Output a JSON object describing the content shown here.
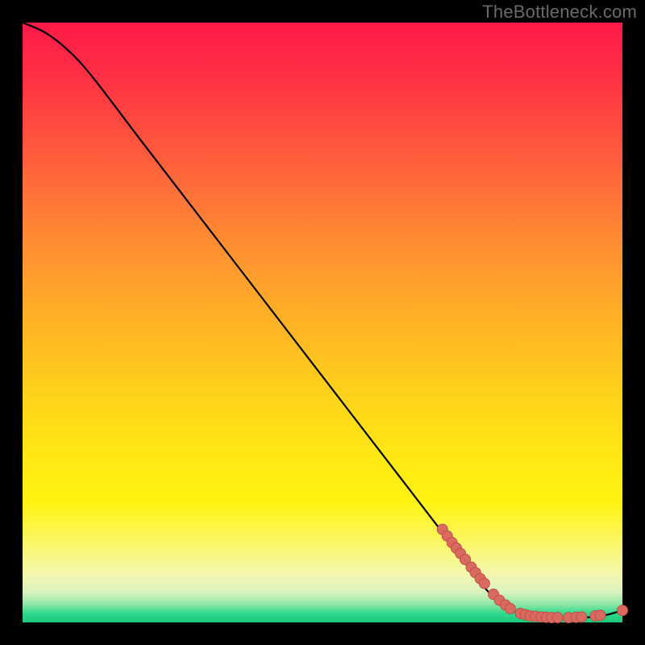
{
  "watermark": "TheBottleneck.com",
  "colors": {
    "page_bg": "#000000",
    "watermark_text": "#6a6a6a",
    "curve_stroke": "#000000",
    "point_fill": "#d86a60",
    "point_stroke": "#c24f45"
  },
  "chart_data": {
    "type": "line",
    "title": "",
    "xlabel": "",
    "ylabel": "",
    "xlim": [
      0,
      100
    ],
    "ylim": [
      0,
      100
    ],
    "curve": [
      {
        "x": 0,
        "y": 100
      },
      {
        "x": 4,
        "y": 98.2
      },
      {
        "x": 8,
        "y": 95.0
      },
      {
        "x": 12,
        "y": 90.5
      },
      {
        "x": 20,
        "y": 80.0
      },
      {
        "x": 30,
        "y": 67.0
      },
      {
        "x": 40,
        "y": 54.0
      },
      {
        "x": 50,
        "y": 41.0
      },
      {
        "x": 60,
        "y": 28.0
      },
      {
        "x": 70,
        "y": 15.0
      },
      {
        "x": 76,
        "y": 7.0
      },
      {
        "x": 80,
        "y": 3.0
      },
      {
        "x": 84,
        "y": 1.2
      },
      {
        "x": 90,
        "y": 0.8
      },
      {
        "x": 96,
        "y": 1.0
      },
      {
        "x": 100,
        "y": 2.0
      }
    ],
    "points": [
      {
        "x": 70.0,
        "y": 15.5
      },
      {
        "x": 70.8,
        "y": 14.4
      },
      {
        "x": 71.6,
        "y": 13.3
      },
      {
        "x": 72.3,
        "y": 12.4
      },
      {
        "x": 73.0,
        "y": 11.5
      },
      {
        "x": 73.8,
        "y": 10.5
      },
      {
        "x": 74.8,
        "y": 9.2
      },
      {
        "x": 75.5,
        "y": 8.3
      },
      {
        "x": 76.3,
        "y": 7.3
      },
      {
        "x": 77.0,
        "y": 6.5
      },
      {
        "x": 78.5,
        "y": 4.7
      },
      {
        "x": 79.5,
        "y": 3.7
      },
      {
        "x": 80.5,
        "y": 2.9
      },
      {
        "x": 81.3,
        "y": 2.3
      },
      {
        "x": 83.0,
        "y": 1.5
      },
      {
        "x": 83.8,
        "y": 1.3
      },
      {
        "x": 84.6,
        "y": 1.1
      },
      {
        "x": 85.5,
        "y": 1.0
      },
      {
        "x": 86.5,
        "y": 0.9
      },
      {
        "x": 87.3,
        "y": 0.85
      },
      {
        "x": 88.2,
        "y": 0.8
      },
      {
        "x": 89.2,
        "y": 0.8
      },
      {
        "x": 91.0,
        "y": 0.8
      },
      {
        "x": 92.3,
        "y": 0.85
      },
      {
        "x": 93.2,
        "y": 0.9
      },
      {
        "x": 95.5,
        "y": 1.1
      },
      {
        "x": 96.3,
        "y": 1.2
      },
      {
        "x": 100.0,
        "y": 2.0
      }
    ]
  }
}
